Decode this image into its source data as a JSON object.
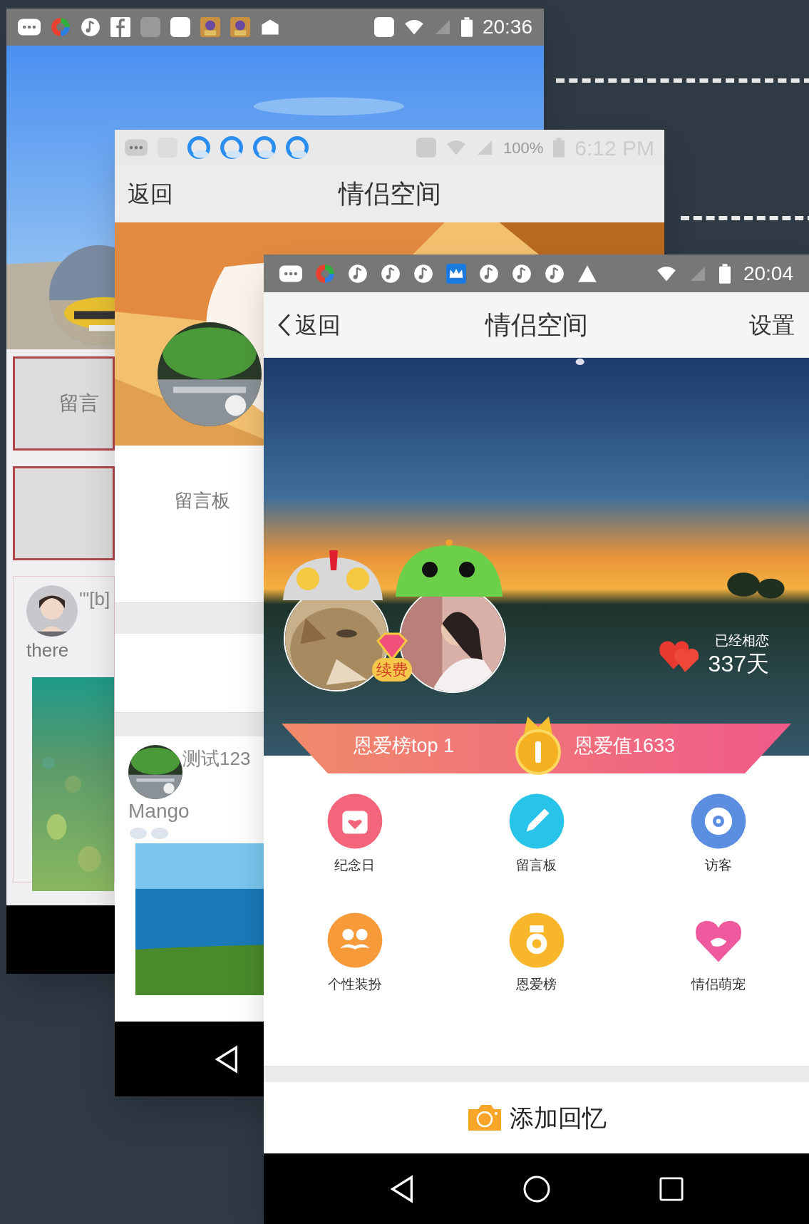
{
  "back_screen": {
    "status_bar": {
      "time": "20:36"
    },
    "message_board_button": "留言",
    "comment": {
      "text": "'\"[b]",
      "name": "there"
    }
  },
  "middle_screen": {
    "status_bar": {
      "battery": "100%",
      "time": "6:12 PM"
    },
    "header": {
      "back": "返回",
      "title": "情侣空间"
    },
    "message_board_label": "留言板",
    "post": {
      "title": "测试123",
      "author": "Mango"
    }
  },
  "front_screen": {
    "status_bar": {
      "time": "20:04"
    },
    "header": {
      "back": "返回",
      "title": "情侣空间",
      "settings": "设置"
    },
    "renew_badge": "续费",
    "relationship": {
      "label": "已经相恋",
      "days": "337天"
    },
    "banner": {
      "rank": "恩爱榜top 1",
      "score": "恩爱值1633"
    },
    "features": [
      {
        "label": "纪念日",
        "kind": "calendar",
        "color": "#f2657b"
      },
      {
        "label": "留言板",
        "kind": "pen",
        "color": "#27c3e8"
      },
      {
        "label": "访客",
        "kind": "eye",
        "color": "#5b8ee0"
      },
      {
        "label": "个性装扮",
        "kind": "mustache",
        "color": "#f79a3a"
      },
      {
        "label": "恩爱榜",
        "kind": "medal",
        "color": "#f8b62b"
      },
      {
        "label": "情侣萌宠",
        "kind": "heart",
        "color": "#ee5a9d"
      }
    ],
    "add_memory": "添加回忆"
  }
}
